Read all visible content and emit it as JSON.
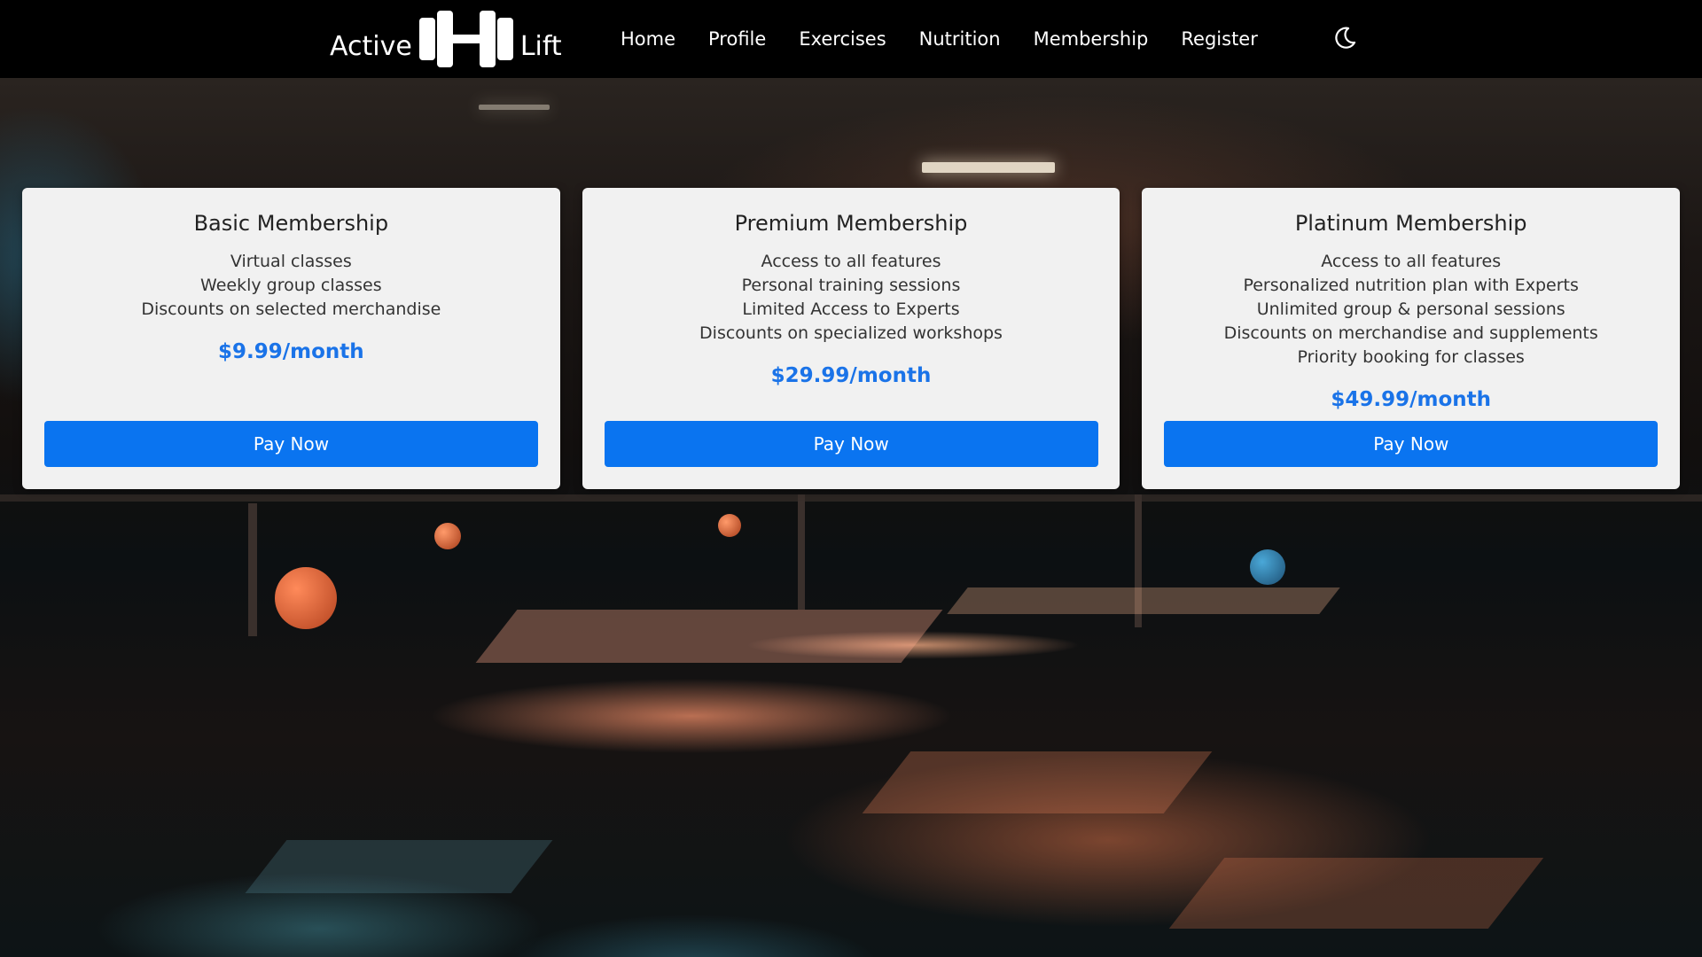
{
  "brand": {
    "name_left": "Active",
    "name_right": "Lift",
    "logo_icon": "dumbbell-icon"
  },
  "nav": {
    "items": [
      {
        "label": "Home"
      },
      {
        "label": "Profile"
      },
      {
        "label": "Exercises"
      },
      {
        "label": "Nutrition"
      },
      {
        "label": "Membership"
      },
      {
        "label": "Register"
      }
    ],
    "theme_toggle_icon": "moon-icon"
  },
  "plans": [
    {
      "title": "Basic Membership",
      "features": [
        "Virtual classes",
        "Weekly group classes",
        "Discounts on selected merchandise"
      ],
      "price": "$9.99/month",
      "button_label": "Pay Now"
    },
    {
      "title": "Premium Membership",
      "features": [
        "Access to all features",
        "Personal training sessions",
        "Limited Access to Experts",
        "Discounts on specialized workshops"
      ],
      "price": "$29.99/month",
      "button_label": "Pay Now"
    },
    {
      "title": "Platinum Membership",
      "features": [
        "Access to all features",
        "Personalized nutrition plan with Experts",
        "Unlimited group & personal sessions",
        "Discounts on merchandise and supplements",
        "Priority booking for classes"
      ],
      "price": "$49.99/month",
      "button_label": "Pay Now"
    }
  ],
  "colors": {
    "navbar_bg": "#000000",
    "card_bg": "#f1f1f1",
    "accent": "#0a74f0",
    "price": "#1a73e8"
  }
}
